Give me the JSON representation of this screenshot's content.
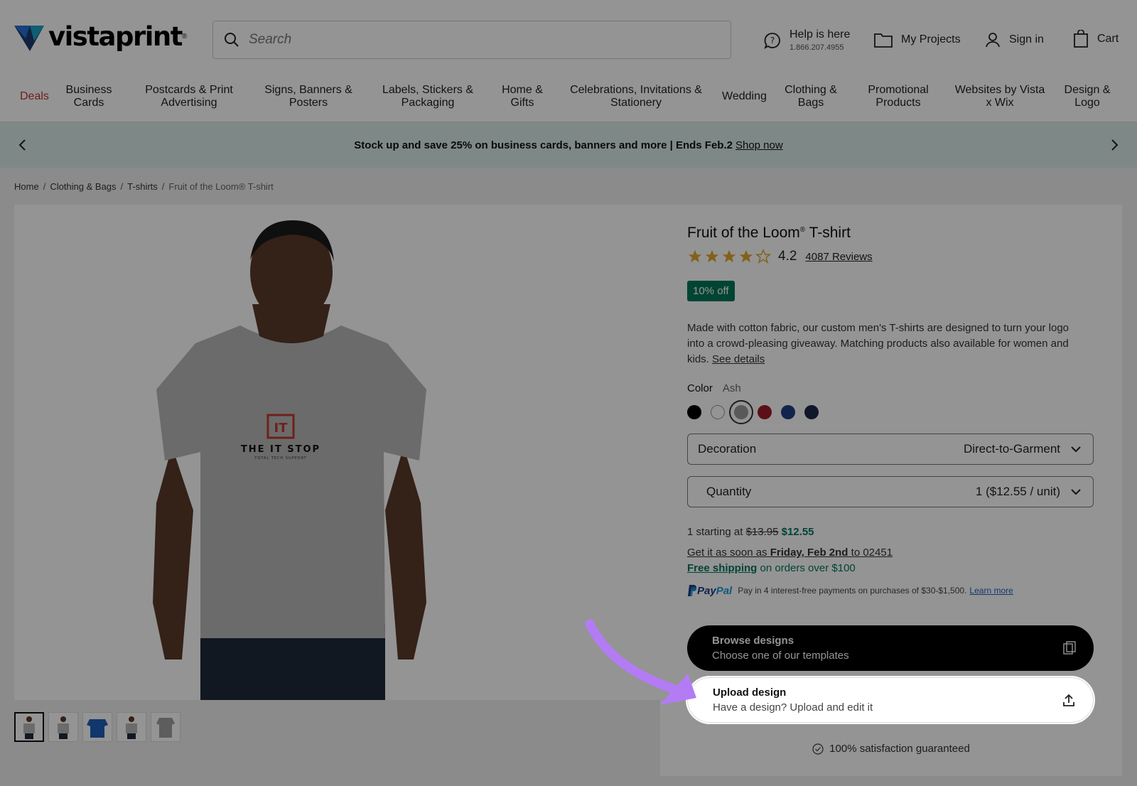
{
  "header": {
    "logo_text": "vistaprint",
    "search_placeholder": "Search",
    "help_title": "Help is here",
    "help_phone": "1.866.207.4955",
    "projects_label": "My Projects",
    "signin_label": "Sign in",
    "cart_label": "Cart"
  },
  "nav": {
    "items": [
      "Deals",
      "Business Cards",
      "Postcards & Print Advertising",
      "Signs, Banners & Posters",
      "Labels, Stickers & Packaging",
      "Home & Gifts",
      "Celebrations, Invitations & Stationery",
      "Wedding",
      "Clothing & Bags",
      "Promotional Products",
      "Websites by Vista x Wix",
      "Design & Logo"
    ]
  },
  "promo": {
    "text": "Stock up and save 25% on business cards, banners and more | Ends Feb.2",
    "link": "Shop now"
  },
  "breadcrumb": [
    "Home",
    "Clothing & Bags",
    "T-shirts",
    "Fruit of the Loom® T-shirt"
  ],
  "product": {
    "title": "Fruit of the Loom",
    "title_mark": "®",
    "title_suffix": " T-shirt",
    "rating": "4.2",
    "stars_value": 4.2,
    "reviews": "4087 Reviews",
    "badge": "10% off",
    "description": "Made with cotton fabric, our custom men's T-shirts are designed to turn your logo into a crowd-pleasing giveaway. Matching products also available for women and kids.",
    "details_link": "See details",
    "color_label": "Color",
    "color_value": "Ash",
    "swatch_colors": [
      "#000000",
      "#ffffff",
      "#9a9a9a",
      "#9e1b2a",
      "#1f3f85",
      "#1c2849"
    ],
    "decoration_label": "Decoration",
    "decoration_value": "Direct-to-Garment",
    "quantity_label": "Quantity",
    "quantity_value": "1 ($12.55 / unit)",
    "price_prefix": "1 starting at",
    "price_old": "$13.95",
    "price_new": "$12.55",
    "ship_prefix": "Get it as soon as",
    "ship_date": "Friday, Feb 2nd",
    "ship_to": "to 02451",
    "free_ship": "Free shipping",
    "free_ship_suffix": "on orders over $100",
    "paypal_brand_1": "Pay",
    "paypal_brand_2": "Pal",
    "paypal_text": "Pay in 4 interest-free payments on purchases of $30-$1,500.",
    "paypal_learn": "Learn more",
    "browse_title": "Browse designs",
    "browse_sub": "Choose one of our templates",
    "upload_title": "Upload design",
    "upload_sub": "Have a design? Upload and edit it",
    "satisfaction": "100% satisfaction guaranteed",
    "shirt_logo": "THE IT STOP",
    "shirt_logo_sub": "TOTAL TECH SUPPORT",
    "shirt_logo_mark": "IT"
  },
  "colors": {
    "accent_green": "#00755b",
    "deals_red": "#c0322b",
    "promo_bg": "#d9ece9",
    "arrow_purple": "#b37cf5"
  }
}
